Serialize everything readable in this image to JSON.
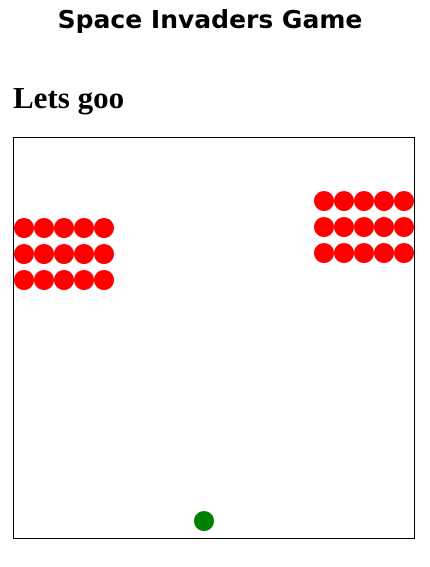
{
  "header": {
    "title": "Space Invaders Game",
    "subtitle": "Lets goo"
  },
  "game": {
    "alien_color": "#ff0000",
    "player_color": "#008000",
    "board_border_color": "#000000",
    "alien_groups": [
      {
        "side": "left",
        "rows": 3,
        "cols": 5
      },
      {
        "side": "right",
        "rows": 3,
        "cols": 5
      }
    ],
    "player": {
      "shape": "circle"
    }
  }
}
